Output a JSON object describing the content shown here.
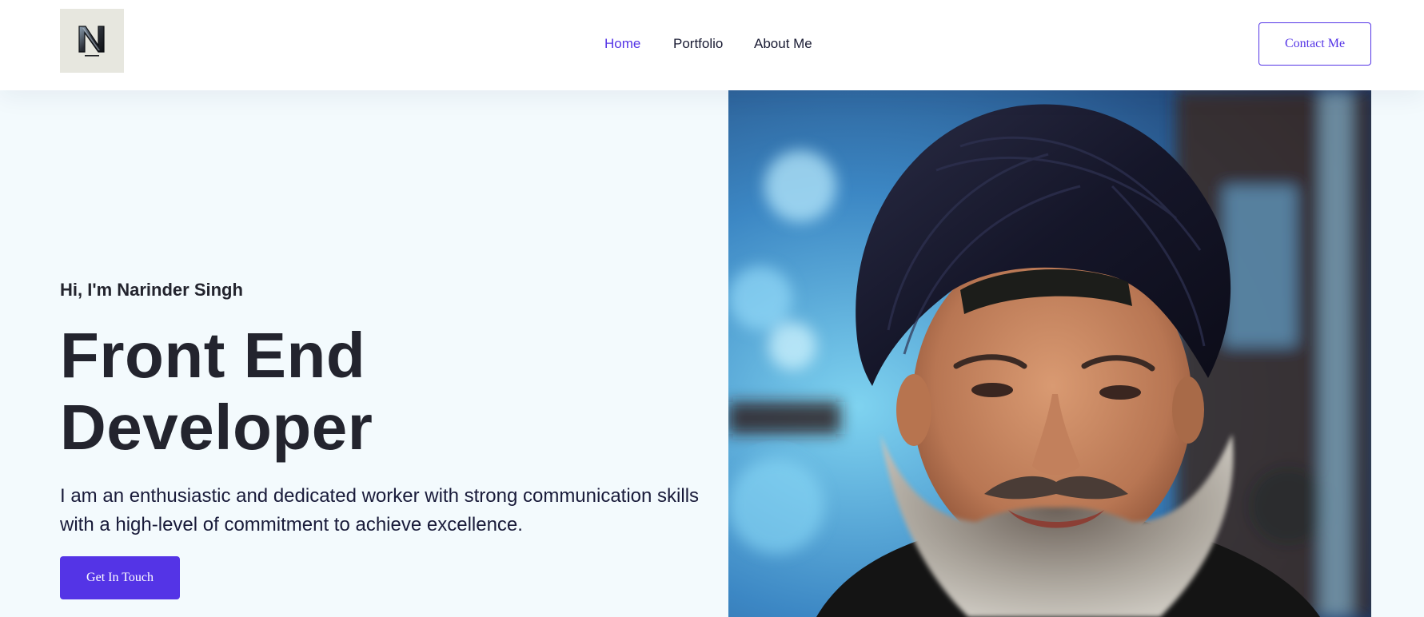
{
  "header": {
    "logo_icon": "n-monogram-logo-icon",
    "nav": [
      {
        "label": "Home",
        "active": true
      },
      {
        "label": "Portfolio",
        "active": false
      },
      {
        "label": "About Me",
        "active": false
      }
    ],
    "contact_label": "Contact Me"
  },
  "hero": {
    "greeting": "Hi, I'm Narinder Singh",
    "title_line1": "Front End",
    "title_line2": "Developer",
    "description": "I am an enthusiastic and dedicated worker with strong communication skills with a high-level of commitment to achieve excellence.",
    "cta_label": "Get In Touch",
    "photo": "portrait-photo"
  },
  "colors": {
    "accent": "#5434e6",
    "heading": "#23242e",
    "background": "#f3fafd",
    "logo_bg": "#e7e7df"
  }
}
